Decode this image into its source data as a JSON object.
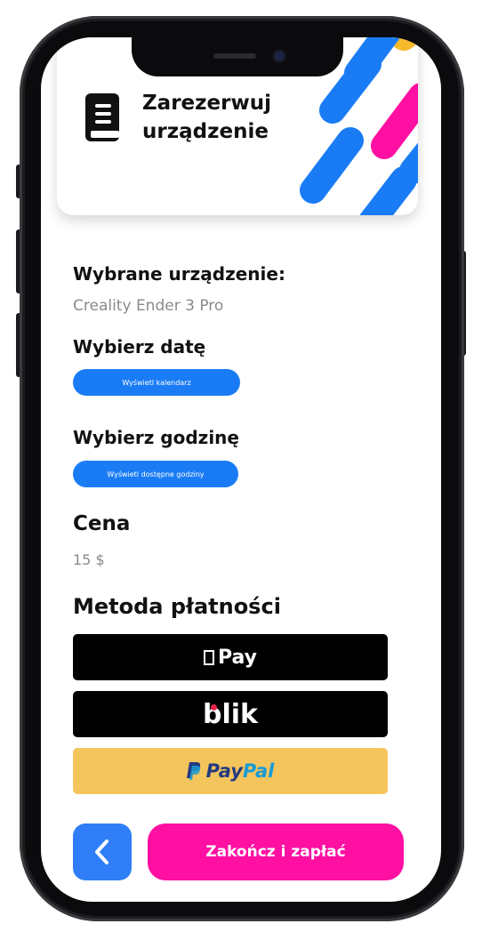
{
  "header": {
    "icon": "book-icon",
    "title_line1": "Zarezerwuj",
    "title_line2": "urządzenie",
    "stripe_colors": [
      "#1a7cf5",
      "#ff0fa2",
      "#f7b82a"
    ]
  },
  "device": {
    "label": "Wybrane urządzenie:",
    "value": "Creality Ender 3 Pro"
  },
  "date": {
    "label": "Wybierz datę",
    "button": "Wyświetl kalendarz"
  },
  "time": {
    "label": "Wybierz godzinę",
    "button": "Wyświetl dostępne godziny"
  },
  "price": {
    "label": "Cena",
    "value": "15 $"
  },
  "payment": {
    "label": "Metoda płatności",
    "apple_pay_label": "Pay",
    "blik_label": "blik",
    "paypal_label_1": "Pay",
    "paypal_label_2": "Pal"
  },
  "footer": {
    "back_icon": "chevron-left-icon",
    "finish_label": "Zakończ i zapłać"
  },
  "colors": {
    "accent_blue": "#1a7cf5",
    "accent_pink": "#ff0fa2",
    "paypal_yellow": "#f5c55d"
  }
}
